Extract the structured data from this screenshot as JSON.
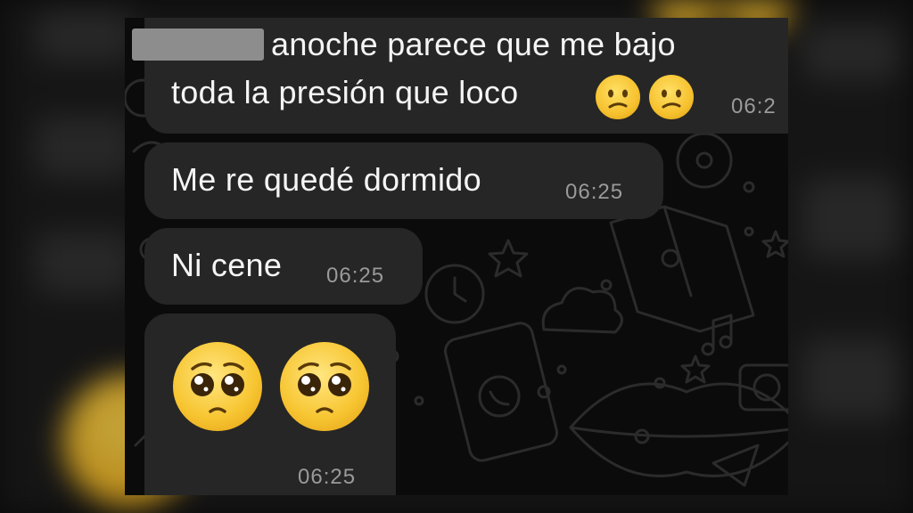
{
  "messages": [
    {
      "line1": "anoche parece que me bajo",
      "line2": "toda la presión que loco",
      "emojis": [
        "confused-face",
        "confused-face"
      ],
      "time": "06:2"
    },
    {
      "text": "Me re quedé dormido",
      "time": "06:25"
    },
    {
      "text": "Ni cene",
      "time": "06:25"
    },
    {
      "emojis": [
        "pleading-face",
        "pleading-face"
      ],
      "time": "06:25"
    }
  ],
  "colors": {
    "bubble": "#262626",
    "background": "#0b0b0b",
    "text": "#f5f5f5",
    "timestamp": "#9a9a9a",
    "emoji_yellow": "#f5c02c"
  }
}
